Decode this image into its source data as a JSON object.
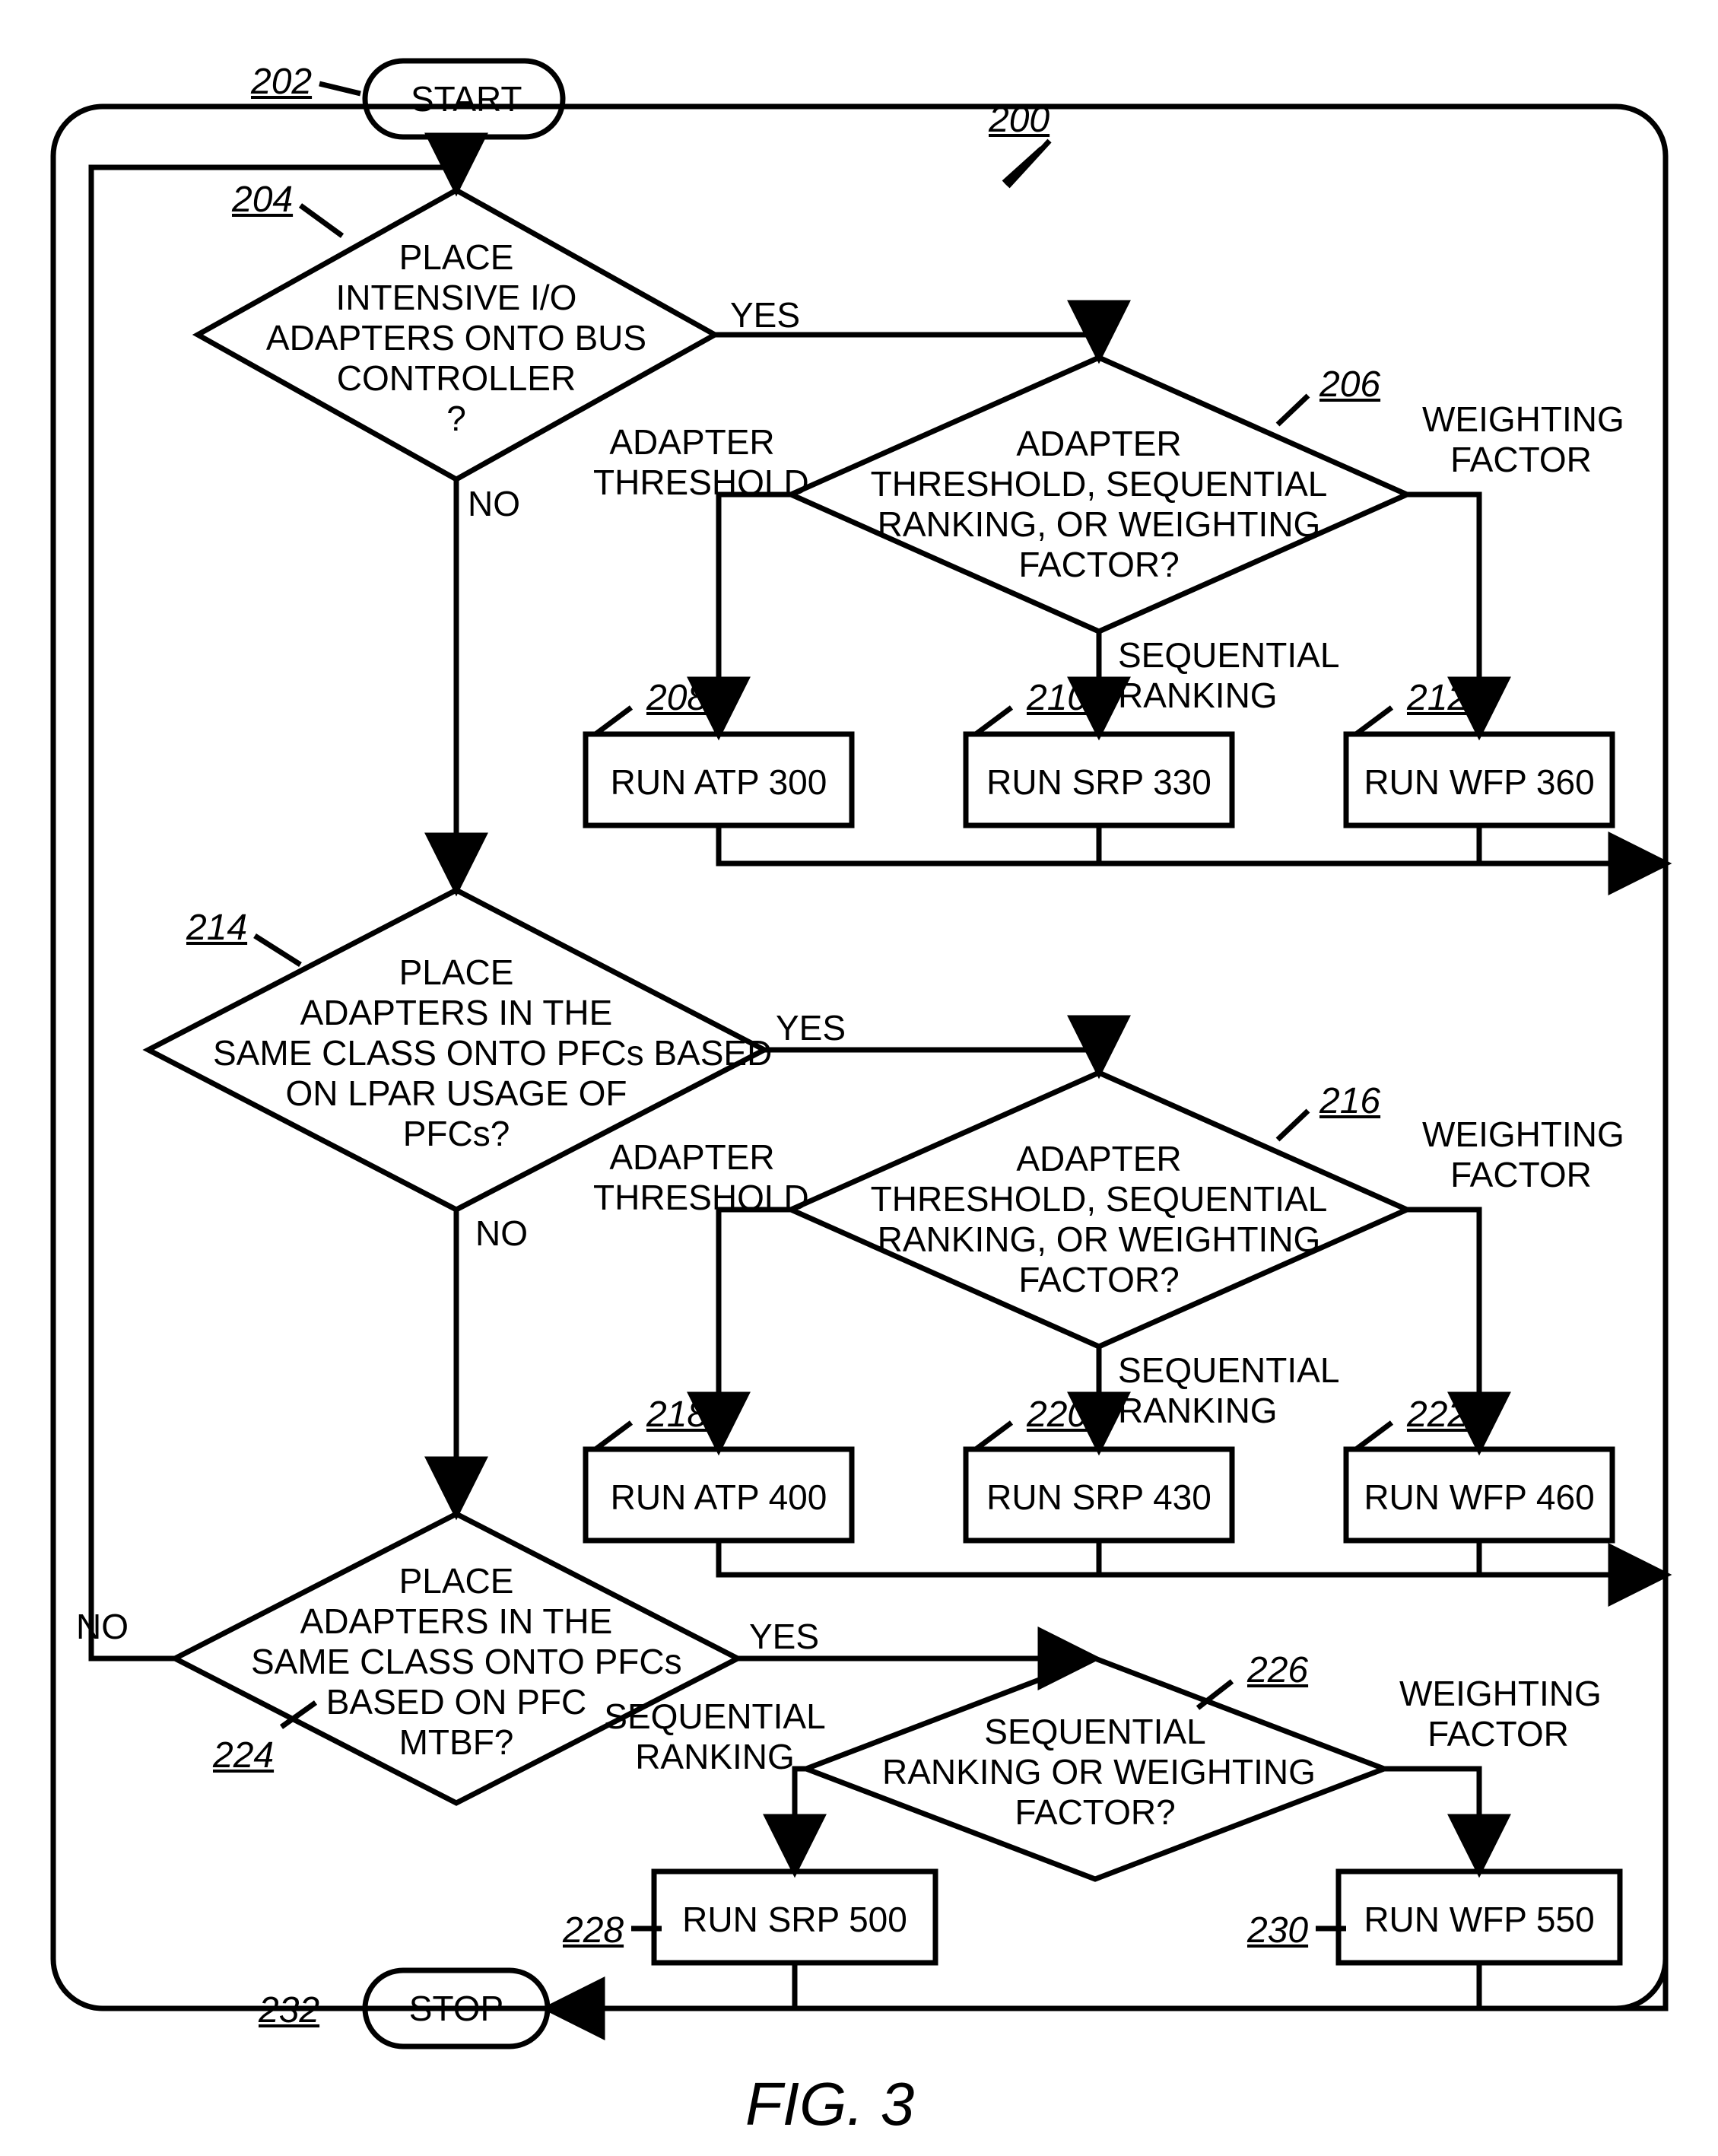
{
  "labels": {
    "l200": "200",
    "l202": "202",
    "l204": "204",
    "l206": "206",
    "l208": "208",
    "l210": "210",
    "l212": "212",
    "l214": "214",
    "l216": "216",
    "l218": "218",
    "l220": "220",
    "l222": "222",
    "l224": "224",
    "l226": "226",
    "l228": "228",
    "l230": "230",
    "l232": "232"
  },
  "nodes": {
    "start": "START",
    "stop": "STOP",
    "d204": "PLACE\nINTENSIVE I/O\nADAPTERS ONTO BUS\nCONTROLLER\n?",
    "d206": "ADAPTER\nTHRESHOLD, SEQUENTIAL\nRANKING, OR WEIGHTING\nFACTOR?",
    "d214": "PLACE\nADAPTERS IN THE\nSAME CLASS ONTO PFCs BASED\nON LPAR USAGE OF\nPFCs?",
    "d216": "ADAPTER\nTHRESHOLD, SEQUENTIAL\nRANKING, OR WEIGHTING\nFACTOR?",
    "d224": "PLACE\nADAPTERS IN THE\nSAME CLASS ONTO PFCs\nBASED ON PFC\nMTBF?",
    "d226": "SEQUENTIAL\nRANKING OR WEIGHTING\nFACTOR?",
    "p208": "RUN ATP 300",
    "p210": "RUN SRP 330",
    "p212": "RUN WFP 360",
    "p218": "RUN ATP 400",
    "p220": "RUN SRP 430",
    "p222": "RUN WFP 460",
    "p228": "RUN SRP 500",
    "p230": "RUN WFP 550"
  },
  "edges": {
    "yes": "YES",
    "no": "NO",
    "adapter_threshold": "ADAPTER\nTHRESHOLD",
    "sequential_ranking": "SEQUENTIAL\nRANKING",
    "weighting_factor": "WEIGHTING\nFACTOR"
  },
  "caption": "FIG. 3"
}
